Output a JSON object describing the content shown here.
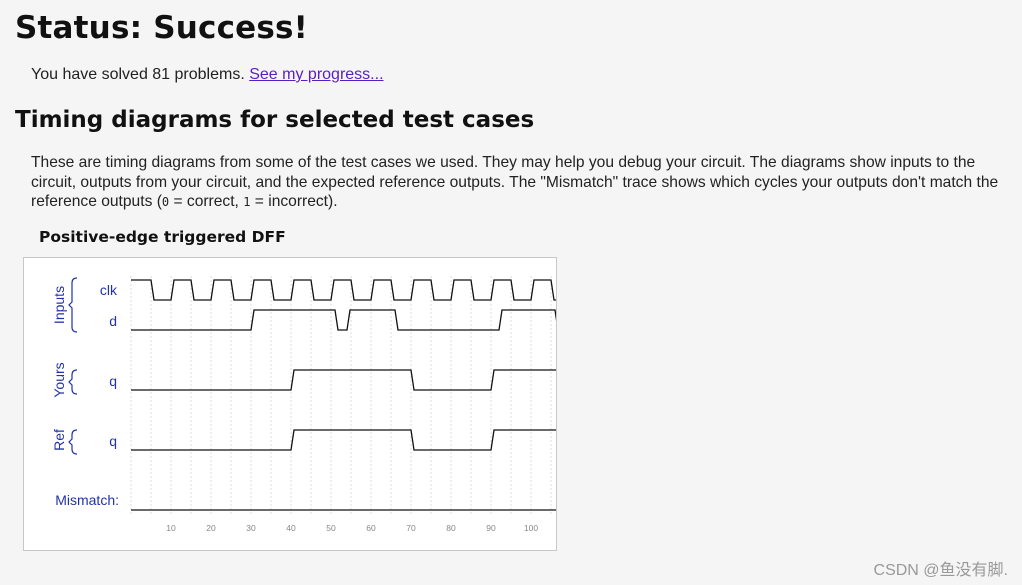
{
  "status": {
    "title": "Status: Success!"
  },
  "progress": {
    "text": "You have solved 81 problems.",
    "link_label": "See my progress..."
  },
  "section": {
    "title": "Timing diagrams for selected test cases",
    "desc_part1": "These are timing diagrams from some of the test cases we used. They may help you debug your circuit. The diagrams show inputs to the circuit, outputs from your circuit, and the expected reference outputs. The \"Mismatch\" trace shows which cycles your outputs don't match the reference outputs (",
    "zero": "0",
    "desc_part2": " = correct, ",
    "one": "1",
    "desc_part3": " = incorrect)."
  },
  "diagram": {
    "title": "Positive-edge triggered DFF",
    "label_color": "#2233aa",
    "groups": {
      "inputs": "Inputs",
      "yours": "Yours",
      "ref": "Ref"
    },
    "signals": {
      "clk": "clk",
      "d": "d",
      "yours_q": "q",
      "ref_q": "q",
      "mismatch": "Mismatch:"
    },
    "time_ticks": [
      "10",
      "20",
      "30",
      "40",
      "50",
      "60",
      "70",
      "80",
      "90",
      "100"
    ],
    "clk_toggle_period": 5,
    "clk_start_high": true,
    "time_range": [
      0,
      110
    ],
    "d_transitions": [
      [
        0,
        0
      ],
      [
        30,
        1
      ],
      [
        51,
        0
      ],
      [
        54,
        1
      ],
      [
        66,
        0
      ],
      [
        92,
        1
      ],
      [
        106,
        0
      ],
      [
        109,
        1
      ]
    ],
    "yours_q_transitions": [
      [
        0,
        0
      ],
      [
        40,
        1
      ],
      [
        70,
        0
      ],
      [
        90,
        1
      ]
    ],
    "ref_q_transitions": [
      [
        0,
        0
      ],
      [
        40,
        1
      ],
      [
        70,
        0
      ],
      [
        90,
        1
      ]
    ],
    "mismatch": [
      [
        0,
        0
      ]
    ]
  },
  "watermark": "CSDN @鱼没有脚."
}
